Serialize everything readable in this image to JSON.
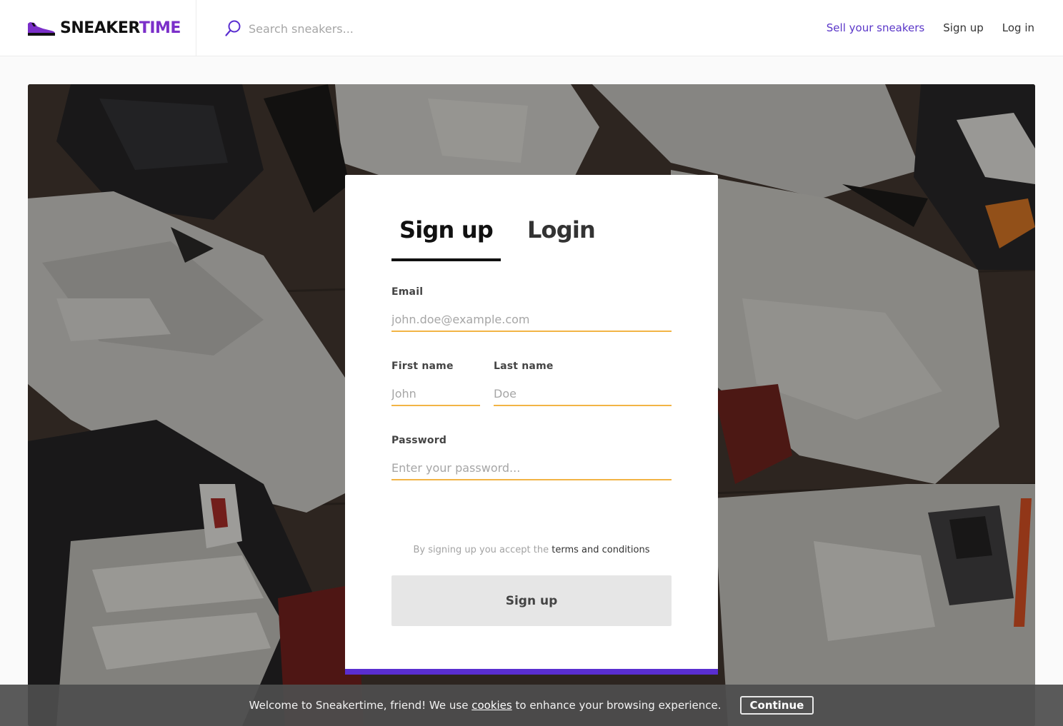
{
  "brand": {
    "name_part1": "SNEAKER",
    "name_part2": "TIME",
    "accent_color": "#7b2fc9"
  },
  "search": {
    "placeholder": "Search sneakers..."
  },
  "nav": {
    "sell": "Sell your sneakers",
    "signup": "Sign up",
    "login": "Log in"
  },
  "form": {
    "tabs": {
      "signup": "Sign up",
      "login": "Login"
    },
    "email": {
      "label": "Email",
      "placeholder": "john.doe@example.com"
    },
    "first_name": {
      "label": "First name",
      "placeholder": "John"
    },
    "last_name": {
      "label": "Last name",
      "placeholder": "Doe"
    },
    "password": {
      "label": "Password",
      "placeholder": "Enter your password..."
    },
    "terms_prefix": "By signing up you accept the",
    "terms_link": "terms and conditions",
    "submit": "Sign up",
    "accent_color": "#5a2ed0",
    "field_underline_color": "#f2b445"
  },
  "cookie": {
    "text_prefix": "Welcome to Sneakertime, friend! We use",
    "link": "cookies",
    "text_suffix": "to enhance your browsing experience.",
    "button": "Continue"
  },
  "icons": {
    "logo": "sneaker-icon",
    "search": "search-icon"
  }
}
